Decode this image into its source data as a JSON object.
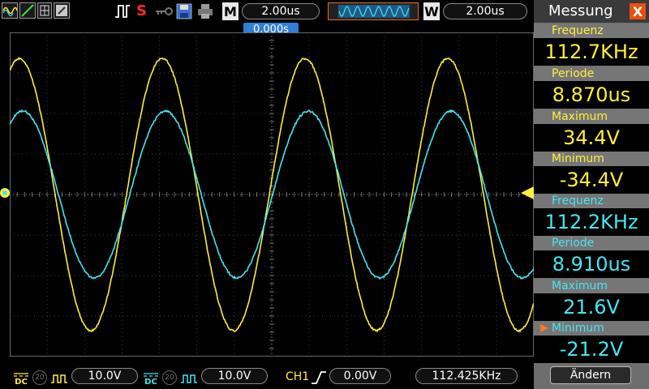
{
  "top": {
    "m_letter": "M",
    "time_base": "2.00us",
    "w_letter": "W",
    "window_time": "2.00us",
    "s_letter": "S"
  },
  "trigger_position": "0.000s",
  "panel": {
    "title": "Messung",
    "close": "X",
    "ch1": {
      "freq_label": "Frequenz",
      "freq": "112.7KHz",
      "period_label": "Periode",
      "period": "8.870us",
      "max_label": "Maximum",
      "max": "34.4V",
      "min_label": "Minimum",
      "min": "-34.4V"
    },
    "ch2": {
      "freq_label": "Frequenz",
      "freq": "112.2KHz",
      "period_label": "Periode",
      "period": "8.910us",
      "max_label": "Maximum",
      "max": "21.6V",
      "min_label": "Minimum",
      "min": "-21.2V"
    },
    "button": "Ändern"
  },
  "bottom": {
    "ch1_coupling": "DC",
    "ch1_bw": "20",
    "ch1_scale": "10.0V",
    "ch2_coupling": "DC",
    "ch2_bw": "20",
    "ch2_scale": "10.0V",
    "trig_source": "CH1",
    "trig_level": "0.00V",
    "trig_freq": "112.425KHz"
  },
  "colors": {
    "ch1": "#ffef3b",
    "ch2": "#44e6f2",
    "trigger_marker": "#2f7fd9",
    "close": "#e8500e"
  }
}
